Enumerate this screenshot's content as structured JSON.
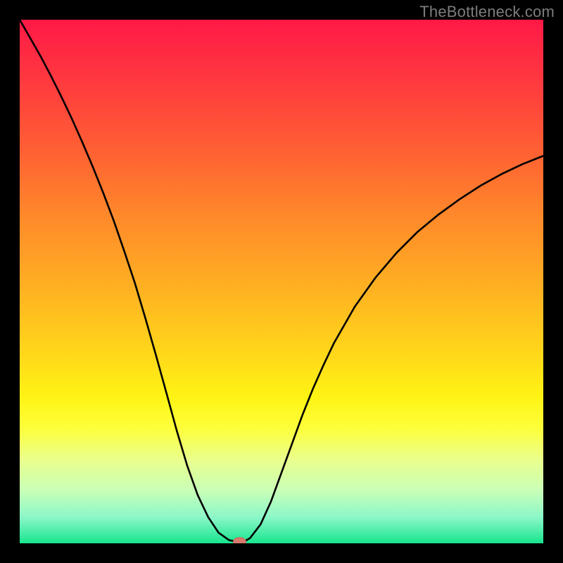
{
  "attribution": "TheBottleneck.com",
  "chart_data": {
    "type": "line",
    "title": "",
    "xlabel": "",
    "ylabel": "",
    "x": [
      0.0,
      0.02,
      0.04,
      0.06,
      0.08,
      0.1,
      0.12,
      0.14,
      0.16,
      0.18,
      0.2,
      0.22,
      0.24,
      0.26,
      0.28,
      0.3,
      0.32,
      0.34,
      0.36,
      0.38,
      0.4,
      0.41,
      0.42,
      0.43,
      0.44,
      0.46,
      0.48,
      0.5,
      0.52,
      0.54,
      0.56,
      0.58,
      0.6,
      0.64,
      0.68,
      0.72,
      0.76,
      0.8,
      0.84,
      0.88,
      0.92,
      0.96,
      1.0
    ],
    "values": [
      1.0,
      0.965,
      0.93,
      0.892,
      0.852,
      0.81,
      0.765,
      0.718,
      0.668,
      0.615,
      0.557,
      0.497,
      0.43,
      0.36,
      0.288,
      0.215,
      0.148,
      0.092,
      0.05,
      0.02,
      0.006,
      0.004,
      0.003,
      0.004,
      0.01,
      0.036,
      0.08,
      0.135,
      0.19,
      0.245,
      0.295,
      0.34,
      0.382,
      0.452,
      0.508,
      0.555,
      0.595,
      0.628,
      0.657,
      0.683,
      0.705,
      0.724,
      0.74
    ],
    "min_point": {
      "x": 0.42,
      "y": 0.003
    },
    "xlim": [
      0,
      1
    ],
    "ylim": [
      0,
      1
    ]
  },
  "colors": {
    "frame": "#000000",
    "curve": "#000000",
    "marker": "#d87a6d",
    "attribution": "#7d7d7d"
  }
}
